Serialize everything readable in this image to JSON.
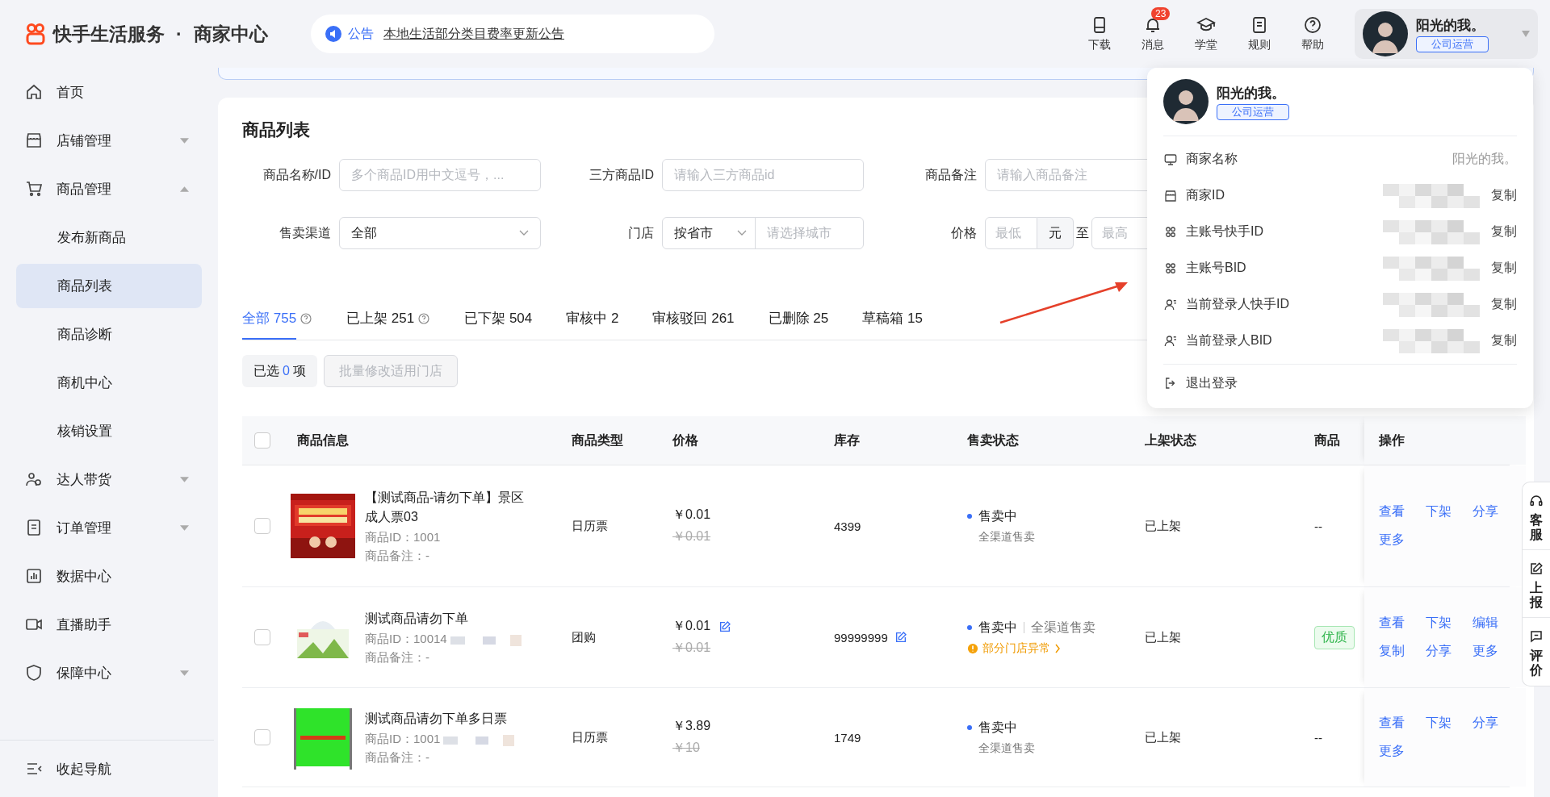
{
  "header": {
    "logo": "快手生活服务",
    "separator": "·",
    "subtitle": "商家中心",
    "notice": {
      "label": "公告",
      "text": "本地生活部分类目费率更新公告"
    },
    "tools": [
      {
        "label": "下载"
      },
      {
        "label": "消息",
        "badge": "23"
      },
      {
        "label": "学堂"
      },
      {
        "label": "规则"
      },
      {
        "label": "帮助"
      }
    ],
    "user": {
      "name": "阳光的我。",
      "role": "公司运营"
    }
  },
  "sidebar": {
    "items": [
      {
        "label": "首页",
        "selected": false
      },
      {
        "label": "店铺管理",
        "selected": false,
        "expanded": false
      },
      {
        "label": "商品管理",
        "selected": false,
        "expanded": true,
        "children": [
          {
            "label": "发布新商品",
            "selected": false
          },
          {
            "label": "商品列表",
            "selected": true
          },
          {
            "label": "商品诊断",
            "selected": false
          },
          {
            "label": "商机中心",
            "selected": false
          },
          {
            "label": "核销设置",
            "selected": false
          }
        ]
      },
      {
        "label": "达人带货",
        "selected": false,
        "expanded": false
      },
      {
        "label": "订单管理",
        "selected": false,
        "expanded": false
      },
      {
        "label": "数据中心",
        "selected": false
      },
      {
        "label": "直播助手",
        "selected": false
      },
      {
        "label": "保障中心",
        "selected": false,
        "expanded": false
      }
    ],
    "collapse": "收起导航"
  },
  "page": {
    "title": "商品列表",
    "filters": [
      {
        "label": "商品名称/ID",
        "kind": "input",
        "placeholder": "多个商品ID用中文逗号，..."
      },
      {
        "label": "三方商品ID",
        "kind": "input",
        "placeholder": "请输入三方商品id"
      },
      {
        "label": "商品备注",
        "kind": "input",
        "placeholder": "请输入商品备注"
      },
      {
        "label": "售卖渠道",
        "kind": "select",
        "value": "全部"
      },
      {
        "label": "门店",
        "kind": "store",
        "value": "按省市",
        "placeholder": "请选择城市"
      },
      {
        "label": "价格",
        "kind": "range",
        "min_placeholder": "最低",
        "unit": "元",
        "separator": "至",
        "max_placeholder": "最高"
      }
    ],
    "tabs": [
      {
        "label": "全部",
        "count": "755",
        "help": true,
        "selected": true
      },
      {
        "label": "已上架",
        "count": "251",
        "help": true,
        "selected": false
      },
      {
        "label": "已下架",
        "count": "504",
        "help": false,
        "selected": false
      },
      {
        "label": "审核中",
        "count": "2",
        "help": false,
        "selected": false
      },
      {
        "label": "审核驳回",
        "count": "261",
        "help": false,
        "selected": false
      },
      {
        "label": "已删除",
        "count": "25",
        "help": false,
        "selected": false
      },
      {
        "label": "草稿箱",
        "count": "15",
        "help": false,
        "selected": false
      }
    ],
    "selection": {
      "label": "已选",
      "count": "0",
      "unit": "项"
    },
    "batch_button": {
      "label": "批量修改适用门店",
      "disabled": true
    },
    "table": {
      "columns": [
        "商品信息",
        "商品类型",
        "价格",
        "库存",
        "售卖状态",
        "上架状态",
        "商品",
        "操作"
      ],
      "all_checked": false,
      "rows": [
        {
          "checked": false,
          "title": "【测试商品-请勿下单】景区成人票03",
          "id": "商品ID：1001",
          "id_redacted": false,
          "note": "商品备注：-",
          "type": "日历票",
          "price": "￥0.01",
          "price_editable": false,
          "original_price": "￥0.01",
          "stock": "4399",
          "stock_editable": false,
          "status": "售卖中",
          "channel": "全渠道售卖",
          "kind": "stacked",
          "listing": "已上架",
          "quality": {
            "kind": "plain",
            "text": "--"
          },
          "actions": [
            "查看",
            "下架",
            "分享",
            "更多"
          ]
        },
        {
          "checked": false,
          "title": "测试商品请勿下单",
          "id": "商品ID：10014",
          "id_redacted": true,
          "note": "商品备注：-",
          "type": "团购",
          "price": "￥0.01",
          "price_editable": true,
          "original_price": "￥0.01",
          "stock": "99999999",
          "stock_editable": true,
          "status": "售卖中",
          "channel": "全渠道售卖",
          "kind": "inline",
          "warning": "部分门店异常",
          "listing": "已上架",
          "quality": {
            "kind": "badge",
            "text": "优质"
          },
          "actions": [
            "查看",
            "下架",
            "编辑",
            "复制",
            "分享",
            "更多"
          ]
        },
        {
          "checked": false,
          "title": "测试商品请勿下单多日票",
          "id": "商品ID：1001",
          "id_redacted": true,
          "note": "商品备注：-",
          "type": "日历票",
          "price": "￥3.89",
          "price_editable": false,
          "original_price": "￥10",
          "stock": "1749",
          "stock_editable": false,
          "status": "售卖中",
          "channel": "全渠道售卖",
          "kind": "stacked",
          "listing": "已上架",
          "quality": {
            "kind": "plain",
            "text": "--"
          },
          "actions": [
            "查看",
            "下架",
            "分享",
            "更多"
          ]
        }
      ]
    }
  },
  "account_menu": {
    "name": "阳光的我。",
    "role": "公司运营",
    "items": [
      {
        "label": "商家名称",
        "value": "阳光的我。",
        "redacted": false
      },
      {
        "label": "商家ID",
        "redacted": true,
        "action": "复制"
      },
      {
        "label": "主账号快手ID",
        "redacted": true,
        "action": "复制"
      },
      {
        "label": "主账号BID",
        "redacted": true,
        "action": "复制"
      },
      {
        "label": "当前登录人快手ID",
        "redacted": true,
        "action": "复制"
      },
      {
        "label": "当前登录人BID",
        "redacted": true,
        "action": "复制"
      }
    ],
    "logout": "退出登录"
  },
  "side_tools": [
    {
      "label": "客服"
    },
    {
      "label": "上报"
    },
    {
      "label": "评价"
    }
  ]
}
